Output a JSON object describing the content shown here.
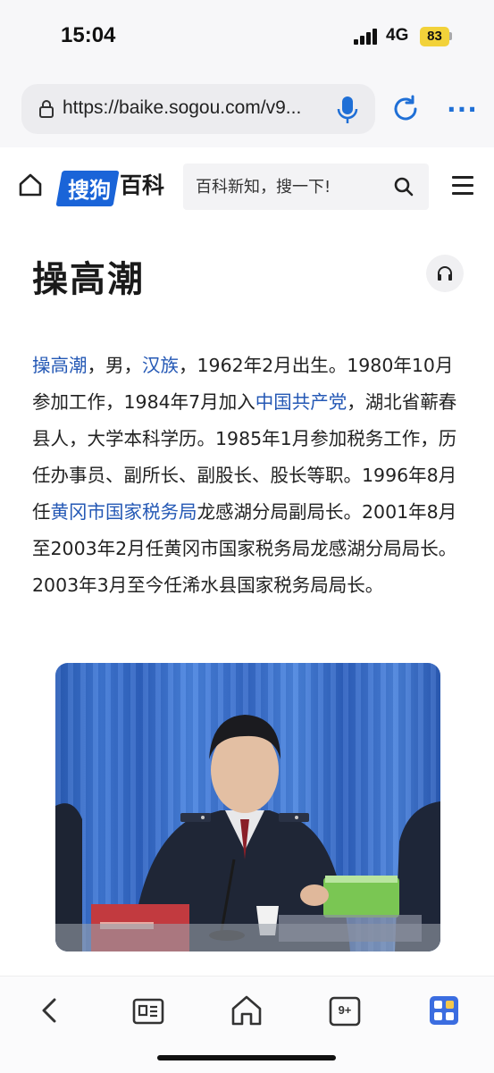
{
  "status_bar": {
    "time": "15:04",
    "network": "4G",
    "battery": "83"
  },
  "browser": {
    "url": "https://baike.sogou.com/v9...",
    "more_label": "···"
  },
  "site": {
    "logo_highlight": "搜狗",
    "logo_rest": "百科",
    "search_placeholder": "百科新知，搜一下!"
  },
  "article": {
    "title": "操高潮",
    "paragraph": [
      {
        "text": "操高潮",
        "link": true
      },
      {
        "text": "，男，",
        "link": false
      },
      {
        "text": "汉族",
        "link": true
      },
      {
        "text": "，1962年2月出生。1980年10月参加工作，1984年7月加入",
        "link": false
      },
      {
        "text": "中国共产党",
        "link": true
      },
      {
        "text": "，湖北省蕲春县人，大学本科学历。1985年1月参加税务工作，历任办事员、副所长、副股长、股长等职。1996年8月任",
        "link": false
      },
      {
        "text": "黄冈市国家税务局",
        "link": true
      },
      {
        "text": "龙感湖分局副局长。2001年8月至2003年2月任黄冈市国家税务局龙感湖分局局长。2003年3月至今任浠水县国家税务局局长。",
        "link": false
      }
    ]
  },
  "bottom_nav": {
    "tabs_count": "9+"
  },
  "colors": {
    "accent": "#1a64d8",
    "link": "#2458b5",
    "tile_accent": "#3b6de0"
  }
}
